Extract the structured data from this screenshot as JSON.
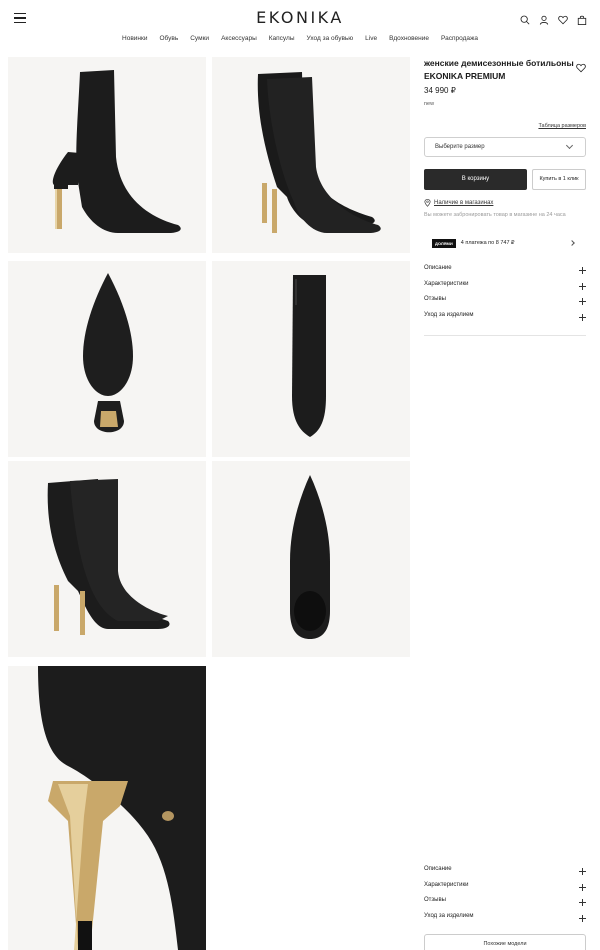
{
  "header": {
    "logo": "EKONIKA",
    "menu_icon": "hamburger-menu-icon",
    "icons": [
      "search-icon",
      "user-icon",
      "heart-icon",
      "bag-icon"
    ]
  },
  "nav": [
    "Новинки",
    "Обувь",
    "Сумки",
    "Аксессуары",
    "Капсулы",
    "Уход за обувью",
    "Live",
    "Вдохновение",
    "Распродажа"
  ],
  "product": {
    "title": "женские демисезонные ботильоны EKONIKA PREMIUM",
    "price": "34 990 ₽",
    "tag": "new",
    "size_table_link": "Таблица размеров",
    "size_placeholder": "Выберите размер",
    "add_to_cart": "В корзину",
    "buy_one_click": "Купить в 1 клик",
    "stores_link": "Наличие в магазинах",
    "reserve_note": "Вы можете забронировать товар в магазине на 24 часа",
    "installment_badge": "ДОЛЯМИ",
    "installment_text": "4 платежа по 8 747 ₽"
  },
  "accordion": [
    "Описание",
    "Характеристики",
    "Отзывы",
    "Уход за изделием"
  ],
  "similar_button": "Похожие модели",
  "colors": {
    "tile_bg": "#f6f5f3",
    "leather": "#1a1a1a",
    "gold": "#c9a86a",
    "button_dark": "#2a2a2a"
  }
}
